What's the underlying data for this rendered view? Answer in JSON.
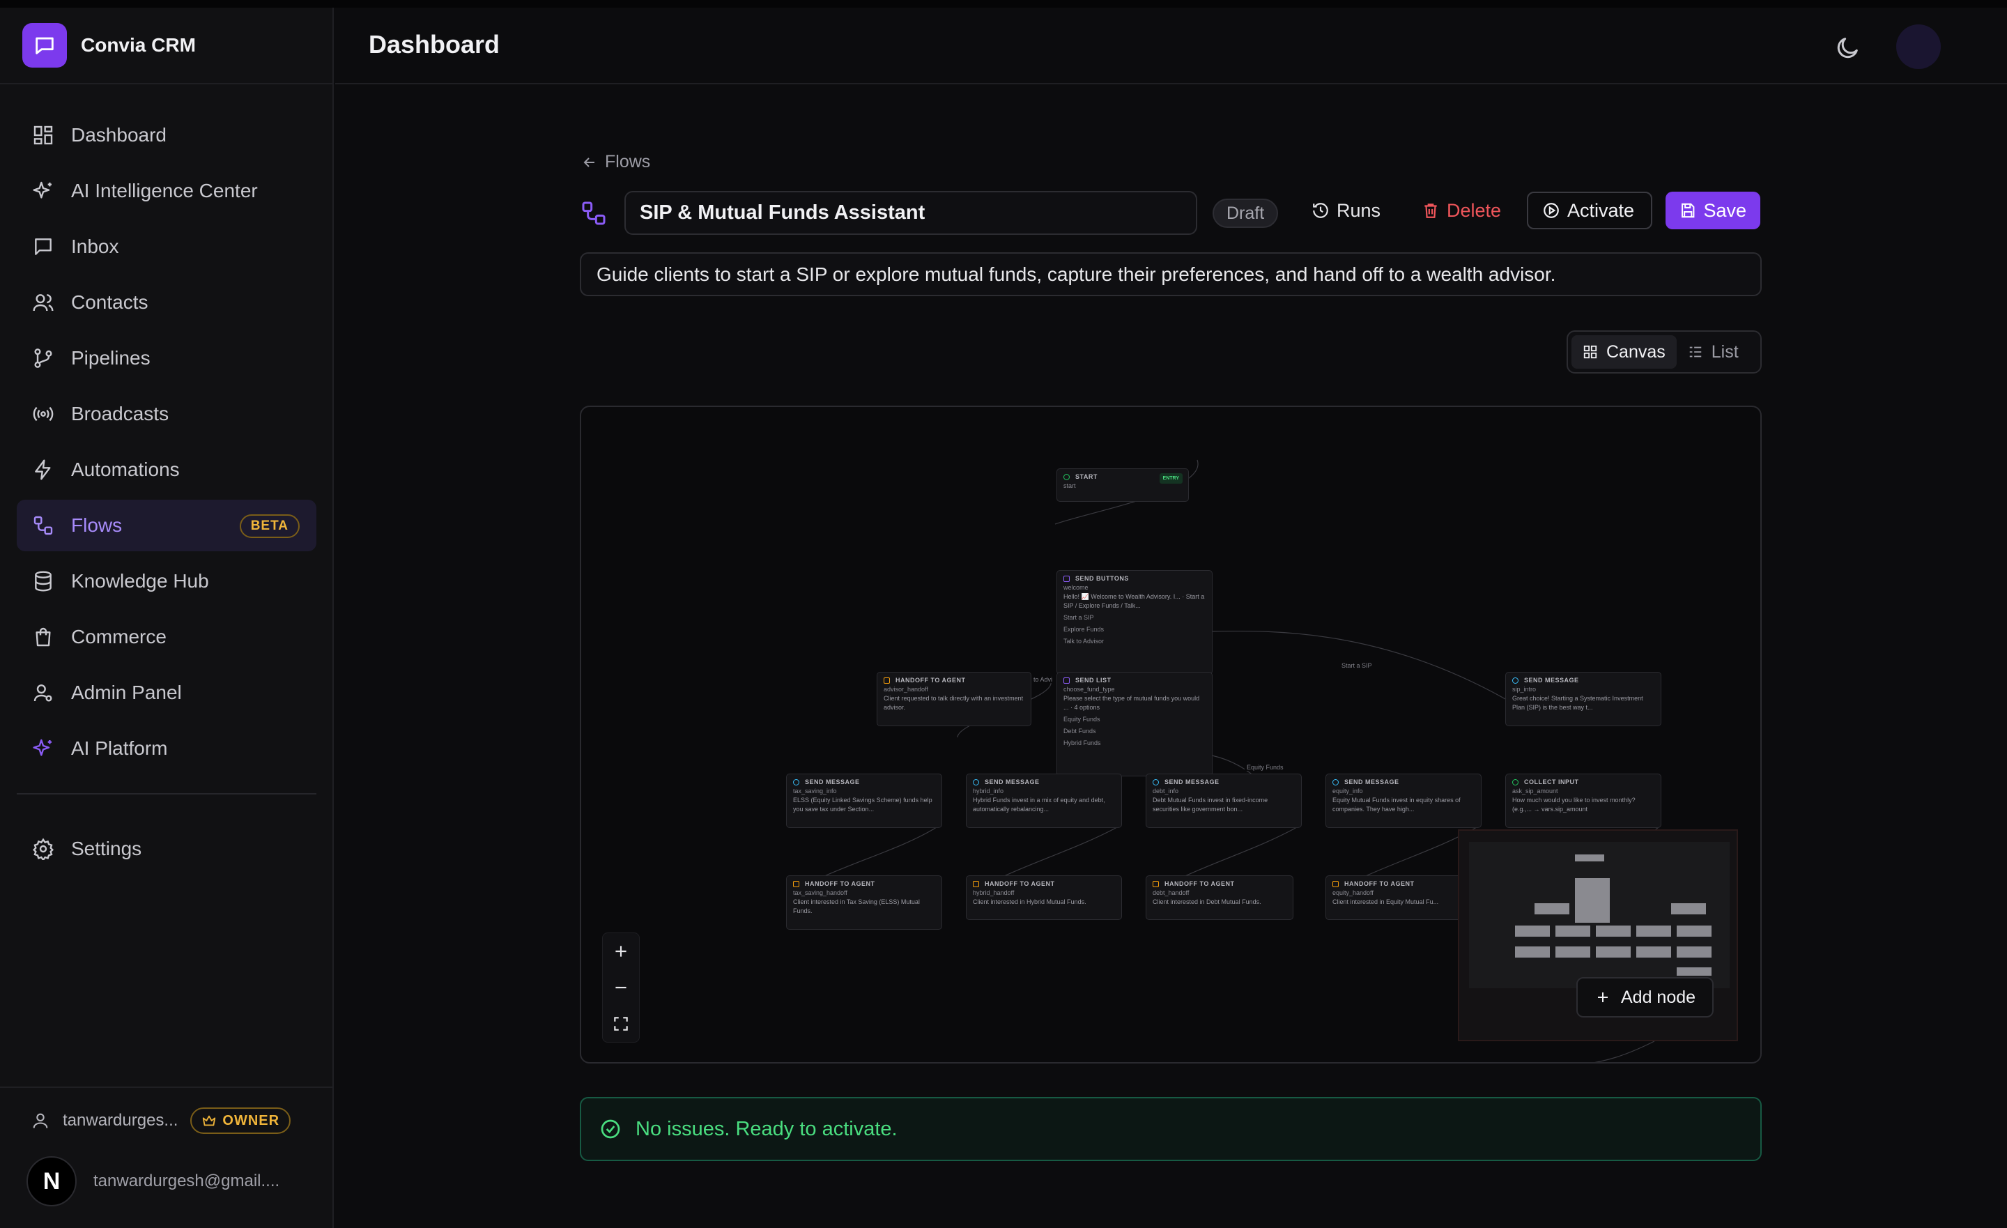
{
  "app": {
    "name": "Convia CRM"
  },
  "header": {
    "title": "Dashboard"
  },
  "sidebar": {
    "items": [
      {
        "label": "Dashboard",
        "icon": "dashboard-icon"
      },
      {
        "label": "AI Intelligence Center",
        "icon": "sparkles-icon"
      },
      {
        "label": "Inbox",
        "icon": "message-icon"
      },
      {
        "label": "Contacts",
        "icon": "users-icon"
      },
      {
        "label": "Pipelines",
        "icon": "git-branch-icon"
      },
      {
        "label": "Broadcasts",
        "icon": "broadcast-icon"
      },
      {
        "label": "Automations",
        "icon": "bolt-icon"
      },
      {
        "label": "Flows",
        "icon": "workflow-icon",
        "badge": "BETA",
        "active": true
      },
      {
        "label": "Knowledge Hub",
        "icon": "database-icon"
      },
      {
        "label": "Commerce",
        "icon": "shopping-bag-icon"
      },
      {
        "label": "Admin Panel",
        "icon": "user-cog-icon"
      },
      {
        "label": "AI Platform",
        "icon": "sparkles-icon"
      }
    ],
    "settings_label": "Settings",
    "user": {
      "name": "tanwardurges...",
      "role": "OWNER",
      "initial": "N",
      "email": "tanwardurgesh@gmail...."
    }
  },
  "editor": {
    "back_label": "Flows",
    "flow_name": "SIP & Mutual Funds Assistant",
    "status": "Draft",
    "buttons": {
      "runs": "Runs",
      "delete": "Delete",
      "activate": "Activate",
      "save": "Save"
    },
    "description": "Guide clients to start a SIP or explore mutual funds, capture their preferences, and hand off to a wealth advisor.",
    "view": {
      "canvas": "Canvas",
      "list": "List"
    },
    "add_node": "Add node",
    "validation": "No issues. Ready to activate."
  },
  "canvas": {
    "entry_badge": "ENTRY",
    "nodes": {
      "start": {
        "type": "START",
        "id": "start"
      },
      "welcome": {
        "type": "SEND BUTTONS",
        "id": "welcome",
        "text": "Hello! 📈 Welcome to Wealth Advisory. I... · Start a SIP / Explore Funds / Talk...",
        "options": [
          "Start a SIP",
          "Explore Funds",
          "Talk to Advisor"
        ]
      },
      "advisor_handoff": {
        "type": "HANDOFF TO AGENT",
        "id": "advisor_handoff",
        "text": "Client requested to talk directly with an investment advisor."
      },
      "choose_fund_type": {
        "type": "SEND LIST",
        "id": "choose_fund_type",
        "text": "Please select the type of mutual funds you would ... · 4 options",
        "options": [
          "Equity Funds",
          "Debt Funds",
          "Hybrid Funds"
        ]
      },
      "sip_intro": {
        "type": "SEND MESSAGE",
        "id": "sip_intro",
        "text": "Great choice! Starting a Systematic Investment Plan (SIP) is the best way t..."
      },
      "tax_saving_info": {
        "type": "SEND MESSAGE",
        "id": "tax_saving_info",
        "text": "ELSS (Equity Linked Savings Scheme) funds help you save tax under Section..."
      },
      "hybrid_info": {
        "type": "SEND MESSAGE",
        "id": "hybrid_info",
        "text": "Hybrid Funds invest in a mix of equity and debt, automatically rebalancing..."
      },
      "debt_info": {
        "type": "SEND MESSAGE",
        "id": "debt_info",
        "text": "Debt Mutual Funds invest in fixed-income securities like government bon..."
      },
      "equity_info": {
        "type": "SEND MESSAGE",
        "id": "equity_info",
        "text": "Equity Mutual Funds invest in equity shares of companies. They have high..."
      },
      "ask_sip_amount": {
        "type": "COLLECT INPUT",
        "id": "ask_sip_amount",
        "text": "How much would you like to invest monthly? (e.g.,... → vars.sip_amount"
      },
      "tax_saving_handoff": {
        "type": "HANDOFF TO AGENT",
        "id": "tax_saving_handoff",
        "text": "Client interested in Tax Saving (ELSS) Mutual Funds."
      },
      "hybrid_handoff": {
        "type": "HANDOFF TO AGENT",
        "id": "hybrid_handoff",
        "text": "Client interested in Hybrid Mutual Funds."
      },
      "debt_handoff": {
        "type": "HANDOFF TO AGENT",
        "id": "debt_handoff",
        "text": "Client interested in Debt Mutual Funds."
      },
      "equity_handoff": {
        "type": "HANDOFF TO AGENT",
        "id": "equity_handoff",
        "text": "Client interested in Equity Mutual Fu..."
      }
    },
    "edge_labels": {
      "start_sip": "Start a SIP",
      "equity": "Equity Funds",
      "advisor": "to Advi"
    }
  },
  "colors": {
    "accent": "#7c3aed",
    "success": "#4ade80",
    "danger": "#f0565b",
    "badge": "#f0b53a"
  }
}
